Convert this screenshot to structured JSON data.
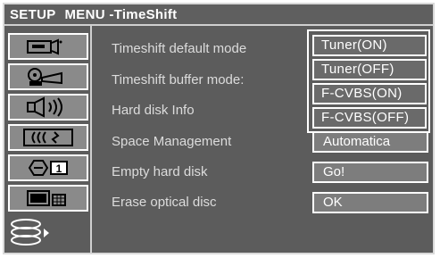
{
  "header": {
    "setup": "SETUP",
    "menu": "MENU -TimeShift"
  },
  "sidebar": {
    "items": [
      {
        "name": "camcorder-icon"
      },
      {
        "name": "film-projector-icon"
      },
      {
        "name": "speaker-icon"
      },
      {
        "name": "subtitle-icon"
      },
      {
        "name": "clock-icon",
        "badge": "1"
      },
      {
        "name": "monitor-icon"
      },
      {
        "name": "disk-stack-icon"
      }
    ]
  },
  "menu": {
    "items": [
      {
        "label": "Timeshift default mode"
      },
      {
        "label": "Timeshift buffer mode:"
      },
      {
        "label": "Hard disk Info"
      },
      {
        "label": "Space Management"
      },
      {
        "label": "Empty hard disk"
      },
      {
        "label": "Erase optical disc"
      }
    ]
  },
  "dropdown": {
    "options": [
      "Tuner(ON)",
      "Tuner(OFF)",
      "F-CVBS(ON)",
      "F-CVBS(OFF)"
    ]
  },
  "values": {
    "space_management": "Automatica",
    "empty_hard_disk": "Go!",
    "erase_optical_disc": "OK"
  }
}
